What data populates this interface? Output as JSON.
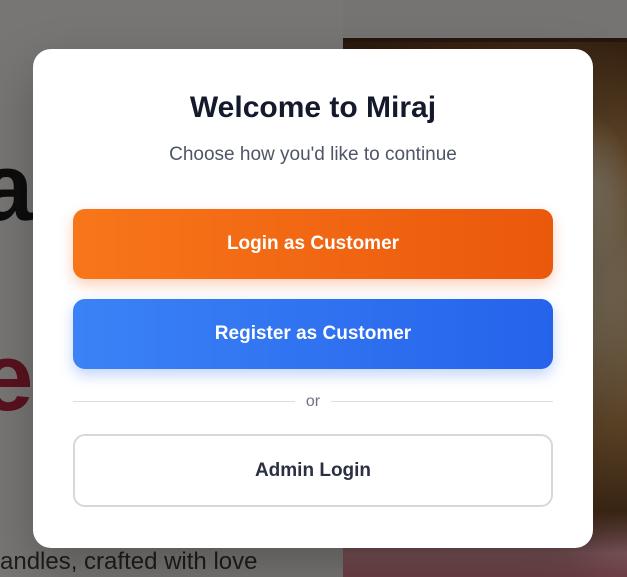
{
  "background": {
    "hero_text": "al",
    "hero_accent_text": "e",
    "tagline": "andles, crafted with love"
  },
  "modal": {
    "title": "Welcome to Miraj",
    "subtitle": "Choose how you'd like to continue",
    "login_customer_label": "Login as Customer",
    "register_customer_label": "Register as Customer",
    "divider_label": "or",
    "admin_login_label": "Admin Login"
  },
  "colors": {
    "login_button": "#ea580c",
    "register_button": "#2563eb",
    "title": "#141a2c"
  }
}
